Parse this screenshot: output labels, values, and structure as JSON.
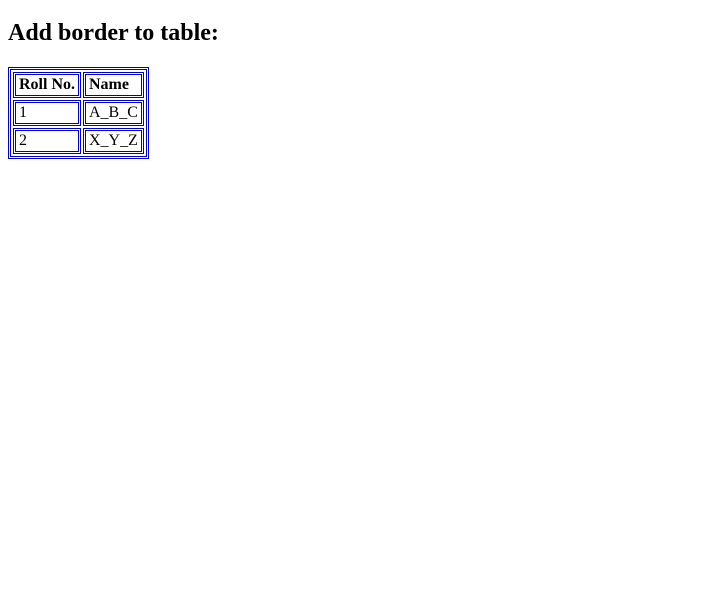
{
  "heading": "Add border to table:",
  "table": {
    "headers": [
      "Roll No.",
      "Name"
    ],
    "rows": [
      {
        "roll": "1",
        "name": "A_B_C"
      },
      {
        "roll": "2",
        "name": "X_Y_Z"
      }
    ]
  }
}
